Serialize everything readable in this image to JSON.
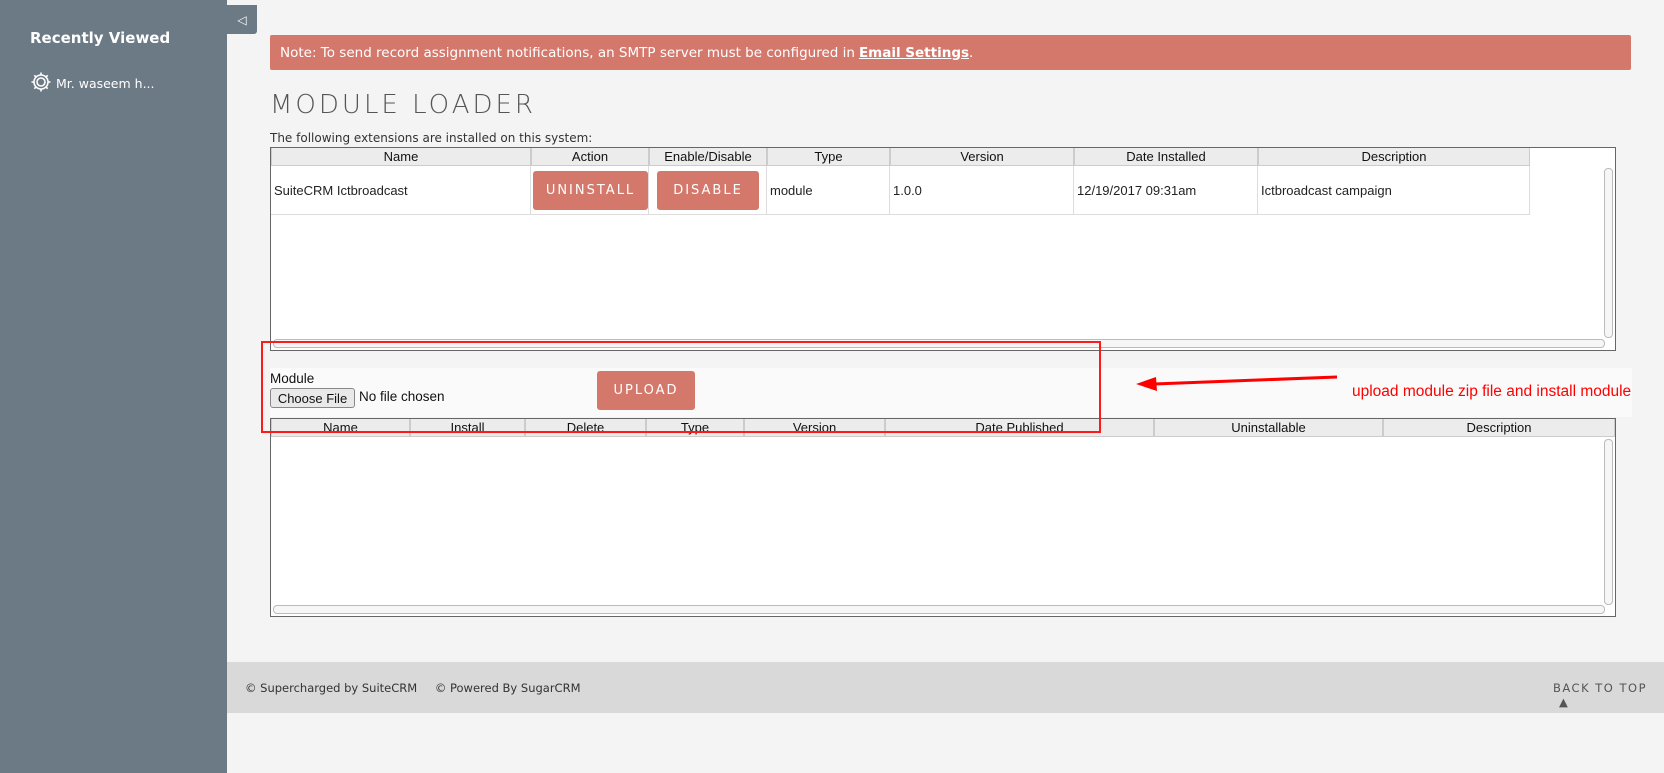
{
  "sidebar": {
    "title": "Recently Viewed",
    "items": [
      {
        "label": "Mr. waseem h...",
        "icon": "gear-icon"
      }
    ],
    "collapse_icon": "◁"
  },
  "notice": {
    "text": "Note: To send record assignment notifications, an SMTP server must be configured in",
    "link": "Email Settings",
    "suffix": ".",
    "color": "#d4786c"
  },
  "page": {
    "title": "MODULE LOADER",
    "installed_note": "The following extensions are installed on this system:"
  },
  "installed_table": {
    "headers": [
      "Name",
      "Action",
      "Enable/Disable",
      "Type",
      "Version",
      "Date Installed",
      "Description"
    ],
    "rows": [
      {
        "name": "SuiteCRM Ictbroadcast",
        "action": "UNINSTALL",
        "enable_disable": "DISABLE",
        "type": "module",
        "version": "1.0.0",
        "date_installed": "12/19/2017 09:31am",
        "description": "Ictbroadcast campaign"
      }
    ]
  },
  "upload": {
    "module_label": "Module",
    "choose_file": "Choose File",
    "no_file": "No file chosen",
    "upload_button": "UPLOAD"
  },
  "available_table": {
    "headers": [
      "Name",
      "Install",
      "Delete",
      "Type",
      "Version",
      "Date Published",
      "Uninstallable",
      "Description"
    ]
  },
  "annotation": {
    "text": "upload module zip file and install module",
    "color": "#ff0000"
  },
  "footer": {
    "supercharged": "© Supercharged by SuiteCRM",
    "powered": "© Powered By SugarCRM",
    "back_to_top": "BACK TO TOP",
    "back_to_top_icon": "▲"
  }
}
